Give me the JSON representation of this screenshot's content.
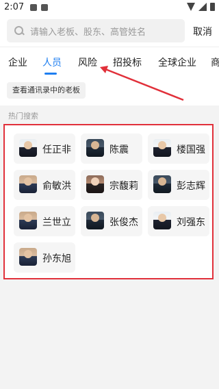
{
  "status": {
    "time": "2:07"
  },
  "search": {
    "placeholder": "请输入老板、股东、高管姓名",
    "cancel_label": "取消"
  },
  "tabs": [
    {
      "label": "企业",
      "active": false
    },
    {
      "label": "人员",
      "active": true
    },
    {
      "label": "风险",
      "active": false
    },
    {
      "label": "招投标",
      "active": false
    },
    {
      "label": "全球企业",
      "active": false
    },
    {
      "label": "商",
      "active": false
    }
  ],
  "contacts_button": "查看通讯录中的老板",
  "hot": {
    "label": "热门搜索",
    "people": [
      {
        "name": "任正非"
      },
      {
        "name": "陈震"
      },
      {
        "name": "楼国强"
      },
      {
        "name": "俞敏洪"
      },
      {
        "name": "宗馥莉"
      },
      {
        "name": "彭志辉"
      },
      {
        "name": "兰世立"
      },
      {
        "name": "张俊杰"
      },
      {
        "name": "刘强东"
      },
      {
        "name": "孙东旭"
      }
    ]
  },
  "colors": {
    "accent": "#1e7ef0",
    "highlight": "#e1303a"
  }
}
